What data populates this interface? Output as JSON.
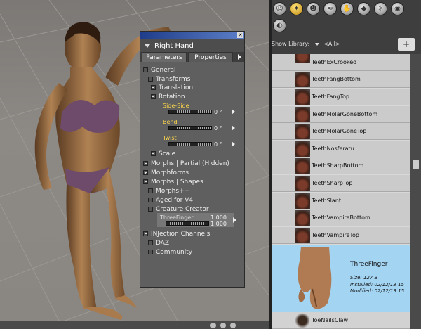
{
  "parameters_window": {
    "title": "Right Hand",
    "tabs": [
      "Parameters",
      "Properties"
    ],
    "tree": [
      {
        "label": "General",
        "expanded": true
      },
      {
        "label": "Transforms",
        "expanded": true
      },
      {
        "label": "Translation",
        "expanded": false
      },
      {
        "label": "Rotation",
        "expanded": true
      },
      {
        "label": "Scale",
        "expanded": true
      },
      {
        "label": "Morphs | Partial (Hidden)",
        "expanded": true
      },
      {
        "label": "Morphforms",
        "expanded": false
      },
      {
        "label": "Morphs | Shapes",
        "expanded": true
      },
      {
        "label": "Morphs++",
        "expanded": true
      },
      {
        "label": "Aged for V4",
        "expanded": true
      },
      {
        "label": "Creature Creator",
        "expanded": true
      },
      {
        "label": "INJection Channels",
        "expanded": true
      },
      {
        "label": "DAZ",
        "expanded": true
      },
      {
        "label": "Community",
        "expanded": true
      }
    ],
    "dials": [
      {
        "label": "Side-Side",
        "value": "0 °"
      },
      {
        "label": "Bend",
        "value": "0 °"
      },
      {
        "label": "Twist",
        "value": "0 °"
      }
    ],
    "morph_dial": {
      "label": "ThreeFinger",
      "value_top": "1.000",
      "value_bottom": "1.000"
    }
  },
  "library": {
    "show_library_label": "Show Library:",
    "show_library_value": "<All>",
    "category_icons": [
      "figures-icon",
      "poses-icon",
      "faces-icon",
      "hair-icon",
      "hands-icon",
      "props-icon",
      "lights-icon",
      "cameras-icon",
      "materials-icon"
    ],
    "items": [
      "TeethExCrooked",
      "TeethFangBottom",
      "TeethFangTop",
      "TeethMolarGoneBottom",
      "TeethMolarGoneTop",
      "TeethNosferatu",
      "TeethSharpBottom",
      "TeethSharpTop",
      "TeethSlant",
      "TeethVampireBottom",
      "TeethVampireTop"
    ],
    "selected": {
      "name": "ThreeFinger",
      "size": "Size:  127 B",
      "installed": "Installed:  02/12/13 15",
      "modified": "Modified:  02/12/13 15"
    },
    "last_item": "ToeNailsClaw"
  }
}
